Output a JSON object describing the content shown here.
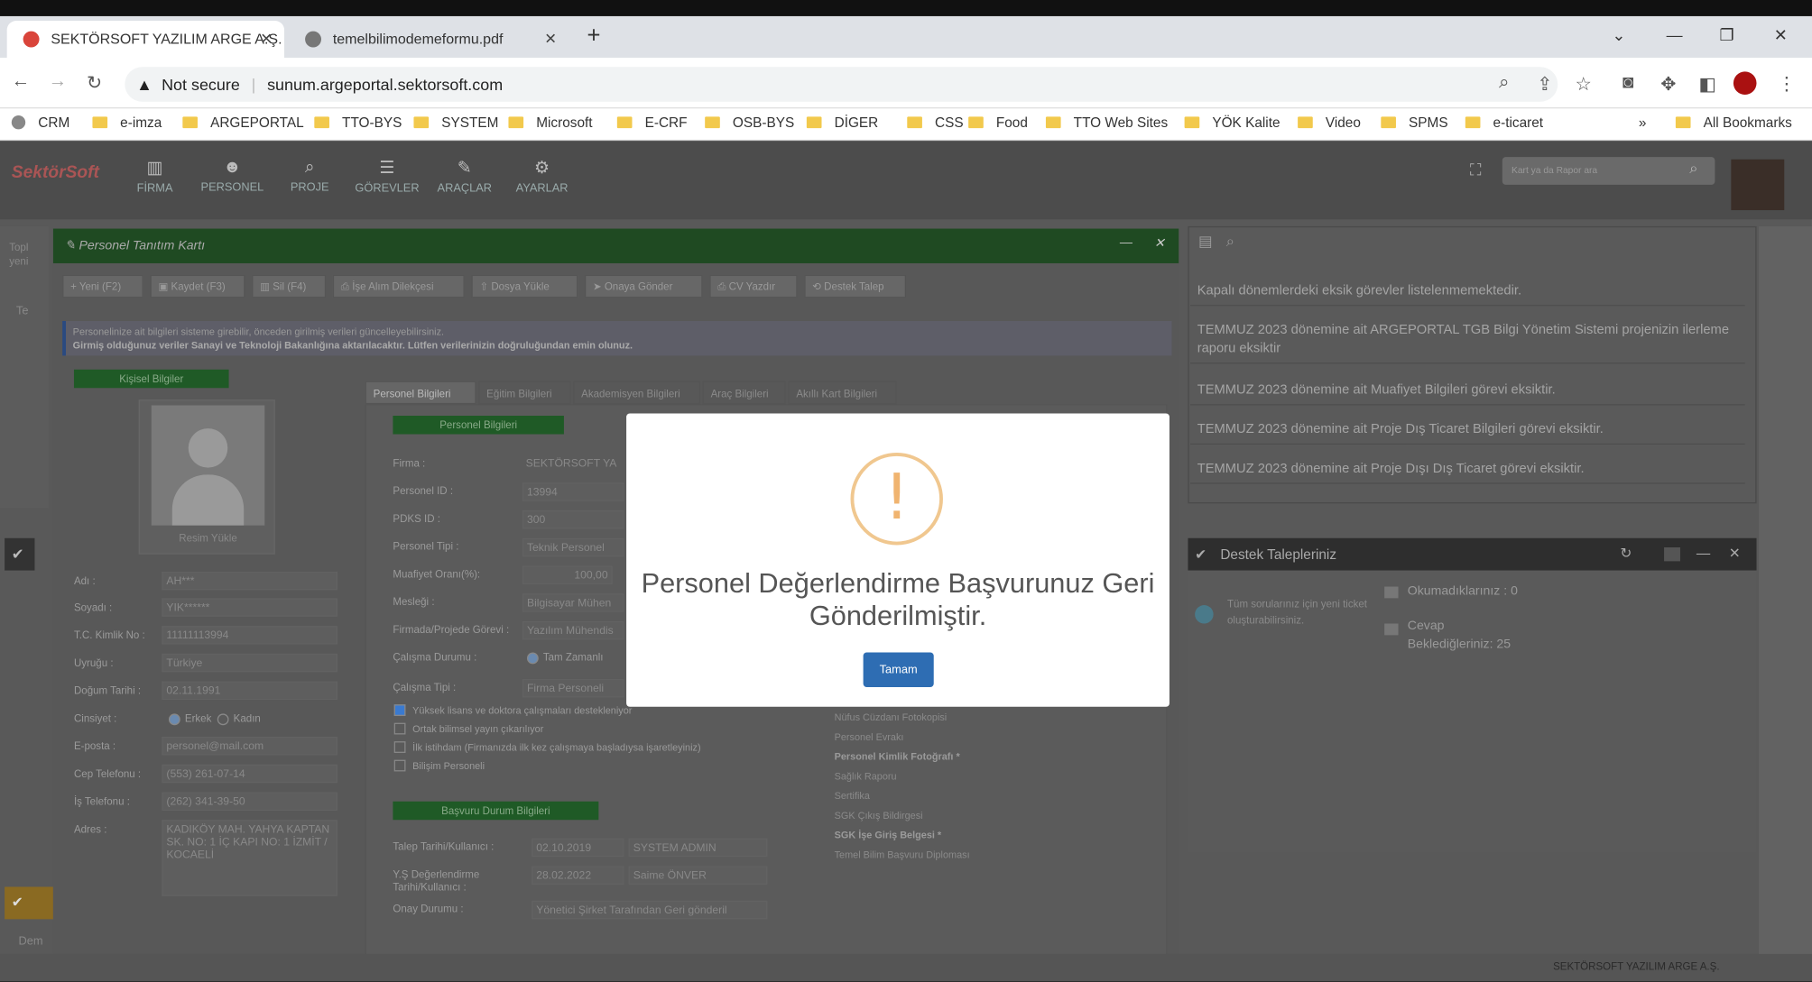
{
  "browser": {
    "tabs": [
      {
        "title": "SEKTÖRSOFT YAZILIM ARGE A.Ş."
      },
      {
        "title": "temelbilimodemeformu.pdf"
      }
    ],
    "security_label": "Not secure",
    "url": "sunum.argeportal.sektorsoft.com",
    "bookmarks": [
      "CRM",
      "e-imza",
      "ARGEPORTAL",
      "TTO-BYS",
      "SYSTEM",
      "Microsoft",
      "E-CRF",
      "OSB-BYS",
      "DİGER",
      "CSS",
      "Food",
      "TTO Web Sites",
      "YÖK Kalite",
      "Video",
      "SPMS",
      "e-ticaret"
    ],
    "all_bookmarks": "All Bookmarks"
  },
  "app": {
    "logo": "SektörSoft",
    "nav": [
      "FİRMA",
      "PERSONEL",
      "PROJE",
      "GÖREVLER",
      "ARAÇLAR",
      "AYARLAR"
    ],
    "search_placeholder": "Kart ya da Rapor ara"
  },
  "card": {
    "title": "Personel Tanıtım Kartı",
    "toolbar": [
      "Yeni (F2)",
      "Kaydet (F3)",
      "Sil (F4)",
      "İşe Alım Dilekçesi",
      "Dosya Yükle",
      "Onaya Gönder",
      "CV Yazdır",
      "Destek Talep"
    ],
    "info_line1": "Personelinize ait bilgileri sisteme girebilir, önceden girilmiş verileri güncelleyebilirsiniz.",
    "info_line2": "Girmiş olduğunuz veriler Sanayi ve Teknoloji Bakanlığına aktarılacaktır. Lütfen verilerinizin doğruluğundan emin olunuz.",
    "personal_header": "Kişisel Bilgiler",
    "upload_photo": "Resim Yükle",
    "fields": [
      {
        "label": "Adı :",
        "value": "AH***"
      },
      {
        "label": "Soyadı :",
        "value": "YIK******"
      },
      {
        "label": "T.C. Kimlik No :",
        "value": "11111113994"
      },
      {
        "label": "Uyruğu :",
        "value": "Türkiye"
      },
      {
        "label": "Doğum Tarihi :",
        "value": "02.11.1991"
      },
      {
        "label": "Cinsiyet :",
        "value": ""
      },
      {
        "label": "E-posta :",
        "value": "personel@mail.com"
      },
      {
        "label": "Cep Telefonu :",
        "value": "(553) 261-07-14"
      },
      {
        "label": "İş Telefonu :",
        "value": "(262) 341-39-50"
      },
      {
        "label": "Adres :",
        "value": "KADIKÖY MAH. YAHYA KAPTAN SK. NO: 1 İÇ KAPI NO: 1 İZMİT / KOCAELİ"
      }
    ],
    "gender_male": "Erkek",
    "gender_female": "Kadın",
    "tabs": [
      "Personel Bilgileri",
      "Eğitim Bilgileri",
      "Akademisyen Bilgileri",
      "Araç Bilgileri",
      "Akıllı Kart Bilgileri"
    ],
    "personnel_header": "Personel Bilgileri",
    "pfields": [
      {
        "label": "Firma :",
        "value": "SEKTÖRSOFT YA"
      },
      {
        "label": "Personel ID :",
        "value": "13994"
      },
      {
        "label": "PDKS ID :",
        "value": "300"
      },
      {
        "label": "Personel Tipi :",
        "value": "Teknik Personel"
      },
      {
        "label": "Muafiyet Oranı(%):",
        "value": "100,00"
      },
      {
        "label": "Mesleği :",
        "value": "Bilgisayar Mühen"
      },
      {
        "label": "Firmada/Projede Görevi :",
        "value": "Yazılım Mühendis"
      },
      {
        "label": "Çalışma Durumu :",
        "value": "Tam Zamanlı"
      },
      {
        "label": "Çalışma Tipi :",
        "value": "Firma Personeli"
      }
    ],
    "checks": [
      "Yüksek lisans ve doktora çalışmaları destekleniyor",
      "Ortak bilimsel yayın çıkarılıyor",
      "İlk istihdam (Firmanızda ilk kez çalışmaya başladıysa işaretleyiniz)",
      "Bilişim Personeli"
    ],
    "docs": [
      "Nüfus Cüzdanı Fotokopisi",
      "Personel Evrakı",
      "Personel Kimlik Fotoğrafı *",
      "Sağlık Raporu",
      "Sertifika",
      "SGK Çıkış Bildirgesi",
      "SGK İşe Giriş Belgesi *",
      "Temel Bilim Başvuru Diploması"
    ],
    "apply_header": "Başvuru Durum Bilgileri",
    "afields": [
      {
        "label": "Talep Tarihi/Kullanıcı :",
        "date": "02.10.2019",
        "user": "SYSTEM ADMIN"
      },
      {
        "label": "Y.Ş Değerlendirme Tarihi/Kullanıcı :",
        "date": "28.02.2022",
        "user": "Saime ÖNVER"
      },
      {
        "label": "Onay Durumu :",
        "date": "Yönetici Şirket Tarafından Geri gönderil",
        "user": ""
      }
    ]
  },
  "notifications": [
    "Kapalı dönemlerdeki eksik görevler listelenmemektedir.",
    "TEMMUZ 2023 dönemine ait ARGEPORTAL TGB Bilgi Yönetim Sistemi projenizin ilerleme raporu eksiktir",
    "TEMMUZ 2023 dönemine ait Muafiyet Bilgileri görevi eksiktir.",
    "TEMMUZ 2023 dönemine ait Proje Dış Ticaret Bilgileri görevi eksiktir.",
    "TEMMUZ 2023 dönemine ait Proje Dışı Dış Ticaret görevi eksiktir."
  ],
  "support": {
    "title": "Destek Talepleriniz",
    "hint": "Tüm sorularınız için yeni ticket oluşturabilirsiniz.",
    "unread": "Okumadıklarınız : 0",
    "waiting_label": "Cevap",
    "waiting": "Beklediğleriniz: 25"
  },
  "left_sidebar": {
    "item1": "Topl yeni",
    "item2": "Te",
    "item3": "Dem"
  },
  "footer": "SEKTÖRSOFT YAZILIM ARGE A.Ş.",
  "modal": {
    "icon": "!",
    "message": "Personel Değerlendirme Başvurunuz Geri Gönderilmiştir.",
    "ok_label": "Tamam"
  }
}
